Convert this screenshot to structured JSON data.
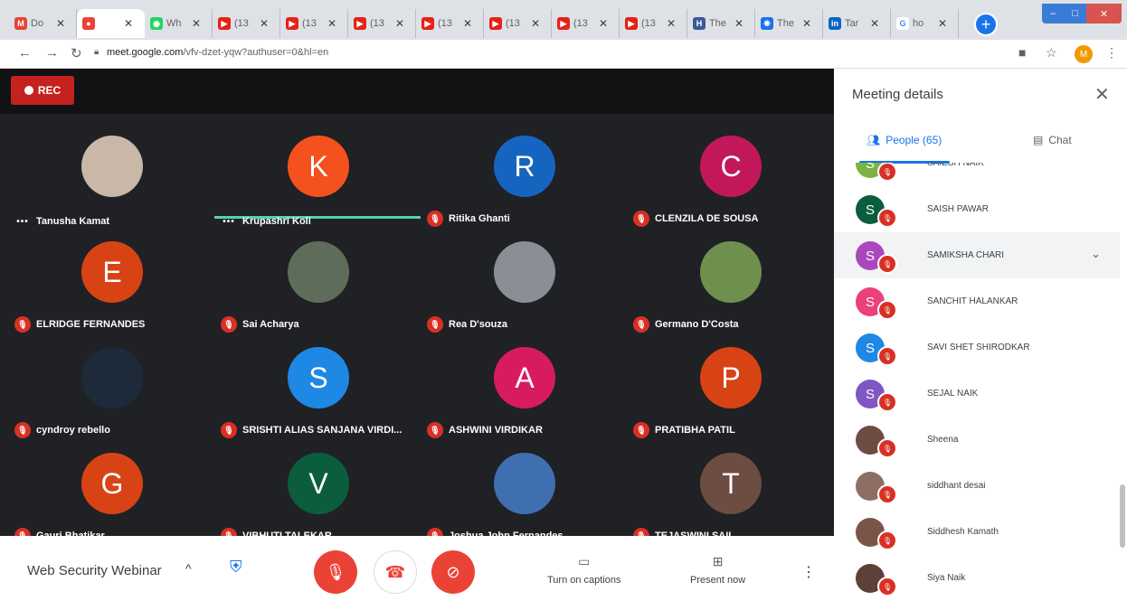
{
  "browser": {
    "tabs": [
      {
        "label": "Do",
        "color": "#ea4335",
        "glyph": "M"
      },
      {
        "label": "",
        "color": "#ea4335",
        "glyph": "●"
      },
      {
        "label": "Wh",
        "color": "#25d366",
        "glyph": "◉"
      },
      {
        "label": "(13",
        "color": "#e62117",
        "glyph": "▶"
      },
      {
        "label": "(13",
        "color": "#e62117",
        "glyph": "▶"
      },
      {
        "label": "(13",
        "color": "#e62117",
        "glyph": "▶"
      },
      {
        "label": "(13",
        "color": "#e62117",
        "glyph": "▶"
      },
      {
        "label": "(13",
        "color": "#e62117",
        "glyph": "▶"
      },
      {
        "label": "(13",
        "color": "#e62117",
        "glyph": "▶"
      },
      {
        "label": "(13",
        "color": "#e62117",
        "glyph": "▶"
      },
      {
        "label": "The",
        "color": "#3b5998",
        "glyph": "H"
      },
      {
        "label": "The",
        "color": "#1a73e8",
        "glyph": "❋"
      },
      {
        "label": "Tar",
        "color": "#0a66c2",
        "glyph": "in"
      },
      {
        "label": "ho",
        "color": "#ffffff",
        "glyph": "G"
      }
    ],
    "url_host": "meet.google.com",
    "url_path": "/vfv-dzet-yqw?authuser=0&hl=en",
    "profile_initial": "M"
  },
  "meeting": {
    "rec_label": "REC",
    "title": "Web Security Webinar",
    "captions_label": "Turn on captions",
    "present_label": "Present now"
  },
  "tiles": [
    {
      "name": "Tanusha Kamat",
      "initial": "",
      "color": "#c9b8a8",
      "status": "dots"
    },
    {
      "name": "Krupashri Koli",
      "initial": "K",
      "color": "#f4511e",
      "status": "dots"
    },
    {
      "name": "Ritika Ghanti",
      "initial": "R",
      "color": "#1565c0",
      "status": "muted"
    },
    {
      "name": "CLENZILA DE SOUSA",
      "initial": "C",
      "color": "#c2185b",
      "status": "muted"
    },
    {
      "name": "ELRIDGE FERNANDES",
      "initial": "E",
      "color": "#d84315",
      "status": "muted"
    },
    {
      "name": "Sai Acharya",
      "initial": "",
      "color": "#5d6d5a",
      "status": "muted"
    },
    {
      "name": "Rea D'souza",
      "initial": "",
      "color": "#8a8f96",
      "status": "muted"
    },
    {
      "name": "Germano D'Costa",
      "initial": "",
      "color": "#6f8f4e",
      "status": "muted"
    },
    {
      "name": "cyndroy rebello",
      "initial": "",
      "color": "#1c2a3a",
      "status": "muted"
    },
    {
      "name": "SRISHTI ALIAS SANJANA VIRDI...",
      "initial": "S",
      "color": "#1e88e5",
      "status": "muted"
    },
    {
      "name": "ASHWINI VIRDIKAR",
      "initial": "A",
      "color": "#d81b60",
      "status": "muted"
    },
    {
      "name": "PRATIBHA PATIL",
      "initial": "P",
      "color": "#d84315",
      "status": "muted"
    },
    {
      "name": "Gauri Bhatikar",
      "initial": "G",
      "color": "#d84315",
      "status": "muted"
    },
    {
      "name": "VIBHUTI TALEKAR",
      "initial": "V",
      "color": "#0b5d3e",
      "status": "muted"
    },
    {
      "name": "Joshua John Fernandes",
      "initial": "",
      "color": "#3f6fae",
      "status": "muted"
    },
    {
      "name": "TEJASWINI SAIL",
      "initial": "T",
      "color": "#6d4c41",
      "status": "muted"
    }
  ],
  "panel": {
    "title": "Meeting details",
    "people_tab": "People (65)",
    "chat_tab": "Chat",
    "people": [
      {
        "name": "SAIESH NAIK",
        "initial": "S",
        "color": "#7cb342"
      },
      {
        "name": "SAISH PAWAR",
        "initial": "S",
        "color": "#0b5d3e"
      },
      {
        "name": "SAMIKSHA CHARI",
        "initial": "S",
        "color": "#ab47bc"
      },
      {
        "name": "SANCHIT HALANKAR",
        "initial": "S",
        "color": "#ec407a"
      },
      {
        "name": "SAVI SHET SHIRODKAR",
        "initial": "S",
        "color": "#1e88e5"
      },
      {
        "name": "SEJAL NAIK",
        "initial": "S",
        "color": "#7e57c2"
      },
      {
        "name": "Sheena",
        "initial": "",
        "color": "#6d4c41"
      },
      {
        "name": "siddhant desai",
        "initial": "",
        "color": "#8d6e63"
      },
      {
        "name": "Siddhesh Kamath",
        "initial": "",
        "color": "#795548"
      },
      {
        "name": "Siya Naik",
        "initial": "",
        "color": "#5d4037"
      }
    ]
  }
}
